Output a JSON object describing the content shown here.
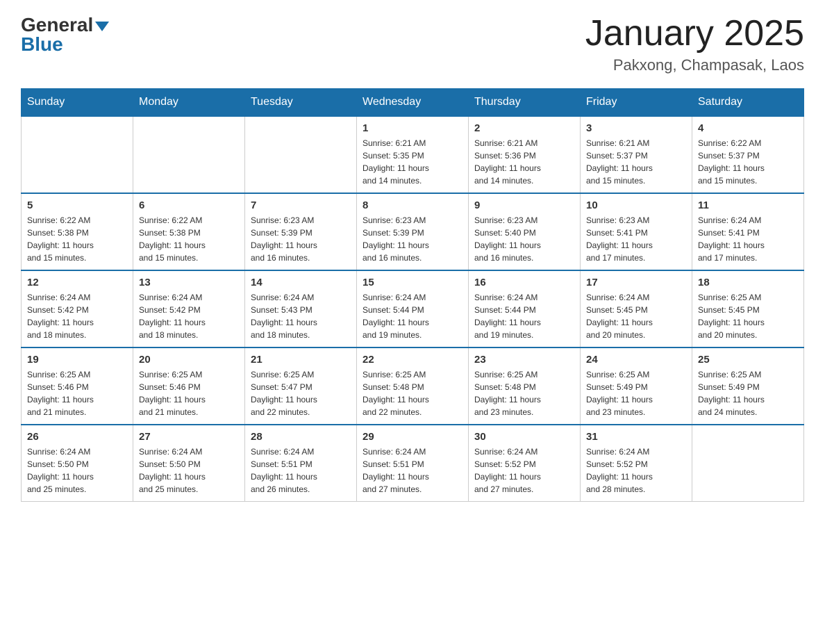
{
  "header": {
    "logo_general": "General",
    "logo_blue": "Blue",
    "title": "January 2025",
    "subtitle": "Pakxong, Champasak, Laos"
  },
  "days_of_week": [
    "Sunday",
    "Monday",
    "Tuesday",
    "Wednesday",
    "Thursday",
    "Friday",
    "Saturday"
  ],
  "weeks": [
    [
      {
        "day": "",
        "info": ""
      },
      {
        "day": "",
        "info": ""
      },
      {
        "day": "",
        "info": ""
      },
      {
        "day": "1",
        "info": "Sunrise: 6:21 AM\nSunset: 5:35 PM\nDaylight: 11 hours\nand 14 minutes."
      },
      {
        "day": "2",
        "info": "Sunrise: 6:21 AM\nSunset: 5:36 PM\nDaylight: 11 hours\nand 14 minutes."
      },
      {
        "day": "3",
        "info": "Sunrise: 6:21 AM\nSunset: 5:37 PM\nDaylight: 11 hours\nand 15 minutes."
      },
      {
        "day": "4",
        "info": "Sunrise: 6:22 AM\nSunset: 5:37 PM\nDaylight: 11 hours\nand 15 minutes."
      }
    ],
    [
      {
        "day": "5",
        "info": "Sunrise: 6:22 AM\nSunset: 5:38 PM\nDaylight: 11 hours\nand 15 minutes."
      },
      {
        "day": "6",
        "info": "Sunrise: 6:22 AM\nSunset: 5:38 PM\nDaylight: 11 hours\nand 15 minutes."
      },
      {
        "day": "7",
        "info": "Sunrise: 6:23 AM\nSunset: 5:39 PM\nDaylight: 11 hours\nand 16 minutes."
      },
      {
        "day": "8",
        "info": "Sunrise: 6:23 AM\nSunset: 5:39 PM\nDaylight: 11 hours\nand 16 minutes."
      },
      {
        "day": "9",
        "info": "Sunrise: 6:23 AM\nSunset: 5:40 PM\nDaylight: 11 hours\nand 16 minutes."
      },
      {
        "day": "10",
        "info": "Sunrise: 6:23 AM\nSunset: 5:41 PM\nDaylight: 11 hours\nand 17 minutes."
      },
      {
        "day": "11",
        "info": "Sunrise: 6:24 AM\nSunset: 5:41 PM\nDaylight: 11 hours\nand 17 minutes."
      }
    ],
    [
      {
        "day": "12",
        "info": "Sunrise: 6:24 AM\nSunset: 5:42 PM\nDaylight: 11 hours\nand 18 minutes."
      },
      {
        "day": "13",
        "info": "Sunrise: 6:24 AM\nSunset: 5:42 PM\nDaylight: 11 hours\nand 18 minutes."
      },
      {
        "day": "14",
        "info": "Sunrise: 6:24 AM\nSunset: 5:43 PM\nDaylight: 11 hours\nand 18 minutes."
      },
      {
        "day": "15",
        "info": "Sunrise: 6:24 AM\nSunset: 5:44 PM\nDaylight: 11 hours\nand 19 minutes."
      },
      {
        "day": "16",
        "info": "Sunrise: 6:24 AM\nSunset: 5:44 PM\nDaylight: 11 hours\nand 19 minutes."
      },
      {
        "day": "17",
        "info": "Sunrise: 6:24 AM\nSunset: 5:45 PM\nDaylight: 11 hours\nand 20 minutes."
      },
      {
        "day": "18",
        "info": "Sunrise: 6:25 AM\nSunset: 5:45 PM\nDaylight: 11 hours\nand 20 minutes."
      }
    ],
    [
      {
        "day": "19",
        "info": "Sunrise: 6:25 AM\nSunset: 5:46 PM\nDaylight: 11 hours\nand 21 minutes."
      },
      {
        "day": "20",
        "info": "Sunrise: 6:25 AM\nSunset: 5:46 PM\nDaylight: 11 hours\nand 21 minutes."
      },
      {
        "day": "21",
        "info": "Sunrise: 6:25 AM\nSunset: 5:47 PM\nDaylight: 11 hours\nand 22 minutes."
      },
      {
        "day": "22",
        "info": "Sunrise: 6:25 AM\nSunset: 5:48 PM\nDaylight: 11 hours\nand 22 minutes."
      },
      {
        "day": "23",
        "info": "Sunrise: 6:25 AM\nSunset: 5:48 PM\nDaylight: 11 hours\nand 23 minutes."
      },
      {
        "day": "24",
        "info": "Sunrise: 6:25 AM\nSunset: 5:49 PM\nDaylight: 11 hours\nand 23 minutes."
      },
      {
        "day": "25",
        "info": "Sunrise: 6:25 AM\nSunset: 5:49 PM\nDaylight: 11 hours\nand 24 minutes."
      }
    ],
    [
      {
        "day": "26",
        "info": "Sunrise: 6:24 AM\nSunset: 5:50 PM\nDaylight: 11 hours\nand 25 minutes."
      },
      {
        "day": "27",
        "info": "Sunrise: 6:24 AM\nSunset: 5:50 PM\nDaylight: 11 hours\nand 25 minutes."
      },
      {
        "day": "28",
        "info": "Sunrise: 6:24 AM\nSunset: 5:51 PM\nDaylight: 11 hours\nand 26 minutes."
      },
      {
        "day": "29",
        "info": "Sunrise: 6:24 AM\nSunset: 5:51 PM\nDaylight: 11 hours\nand 27 minutes."
      },
      {
        "day": "30",
        "info": "Sunrise: 6:24 AM\nSunset: 5:52 PM\nDaylight: 11 hours\nand 27 minutes."
      },
      {
        "day": "31",
        "info": "Sunrise: 6:24 AM\nSunset: 5:52 PM\nDaylight: 11 hours\nand 28 minutes."
      },
      {
        "day": "",
        "info": ""
      }
    ]
  ]
}
